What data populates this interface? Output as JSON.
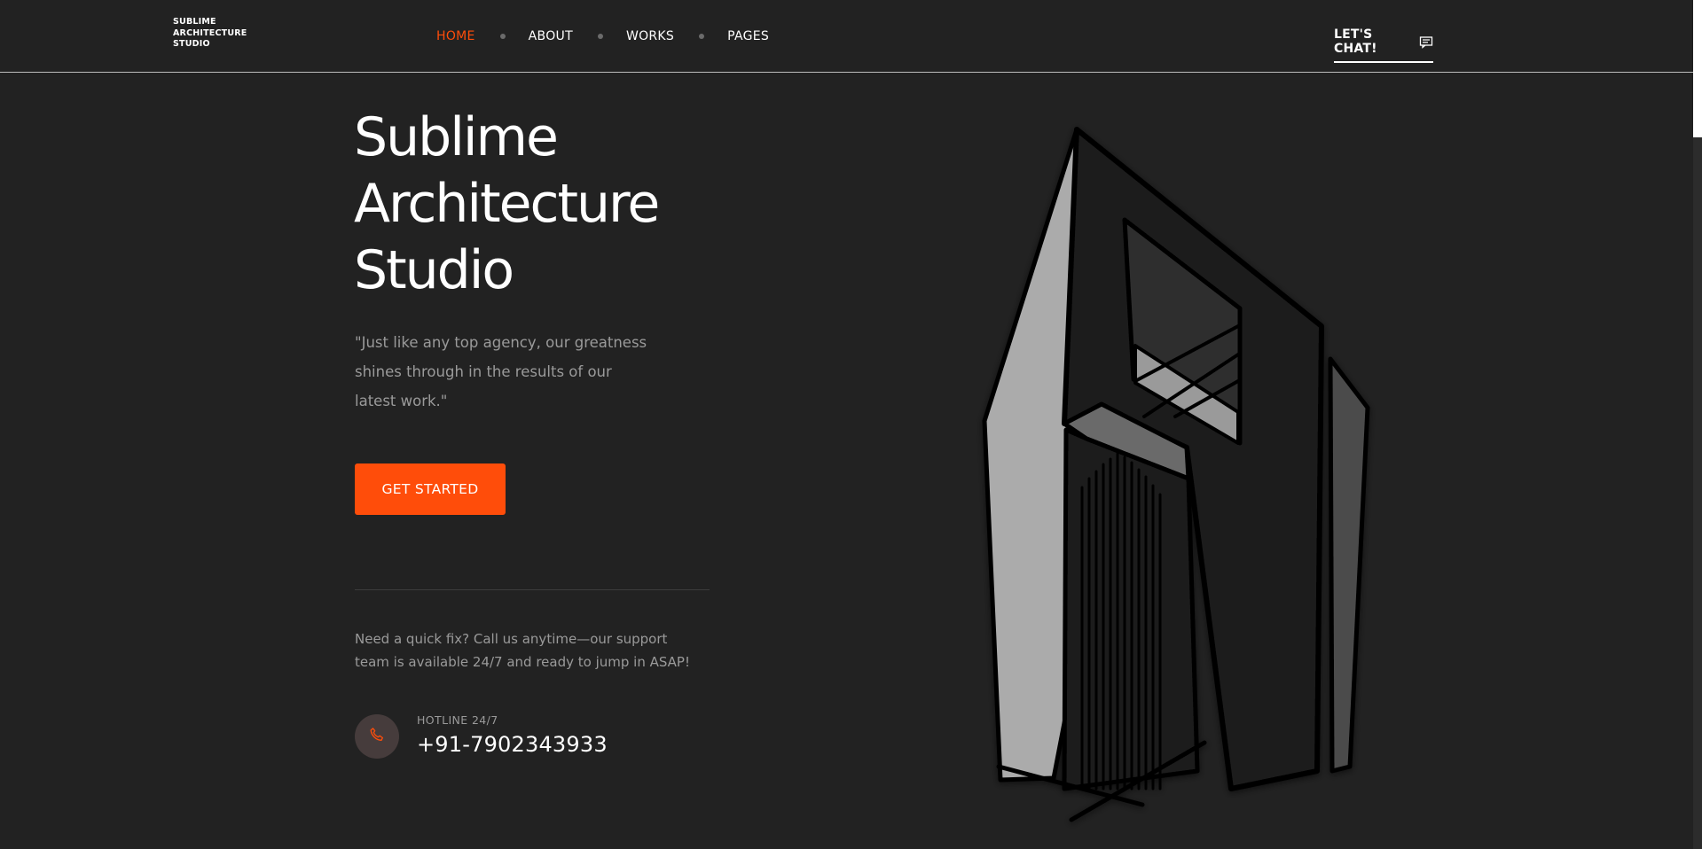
{
  "header": {
    "logo_lines": [
      "SUBLIME",
      "ARCHITECTURE",
      "STUDIO"
    ],
    "nav": [
      {
        "label": "HOME",
        "active": true
      },
      {
        "label": "ABOUT",
        "active": false
      },
      {
        "label": "WORKS",
        "active": false
      },
      {
        "label": "PAGES",
        "active": false
      }
    ],
    "cta_label": "LET'S CHAT!",
    "cta_icon": "chat-icon"
  },
  "hero": {
    "title_lines": [
      "Sublime",
      "Architecture",
      "Studio"
    ],
    "quote": "\"Just like any top agency, our greatness shines through in the results of our latest work.\"",
    "button_label": "GET STARTED"
  },
  "support": {
    "text": "Need a quick fix? Call us anytime—our support team is available 24/7 and ready to jump in ASAP!",
    "hotline_label": "HOTLINE 24/7",
    "phone": "+91-7902343933",
    "phone_icon": "phone-icon"
  },
  "colors": {
    "background": "#222222",
    "accent": "#ff4d0a",
    "muted_text": "#9a9a9a"
  }
}
